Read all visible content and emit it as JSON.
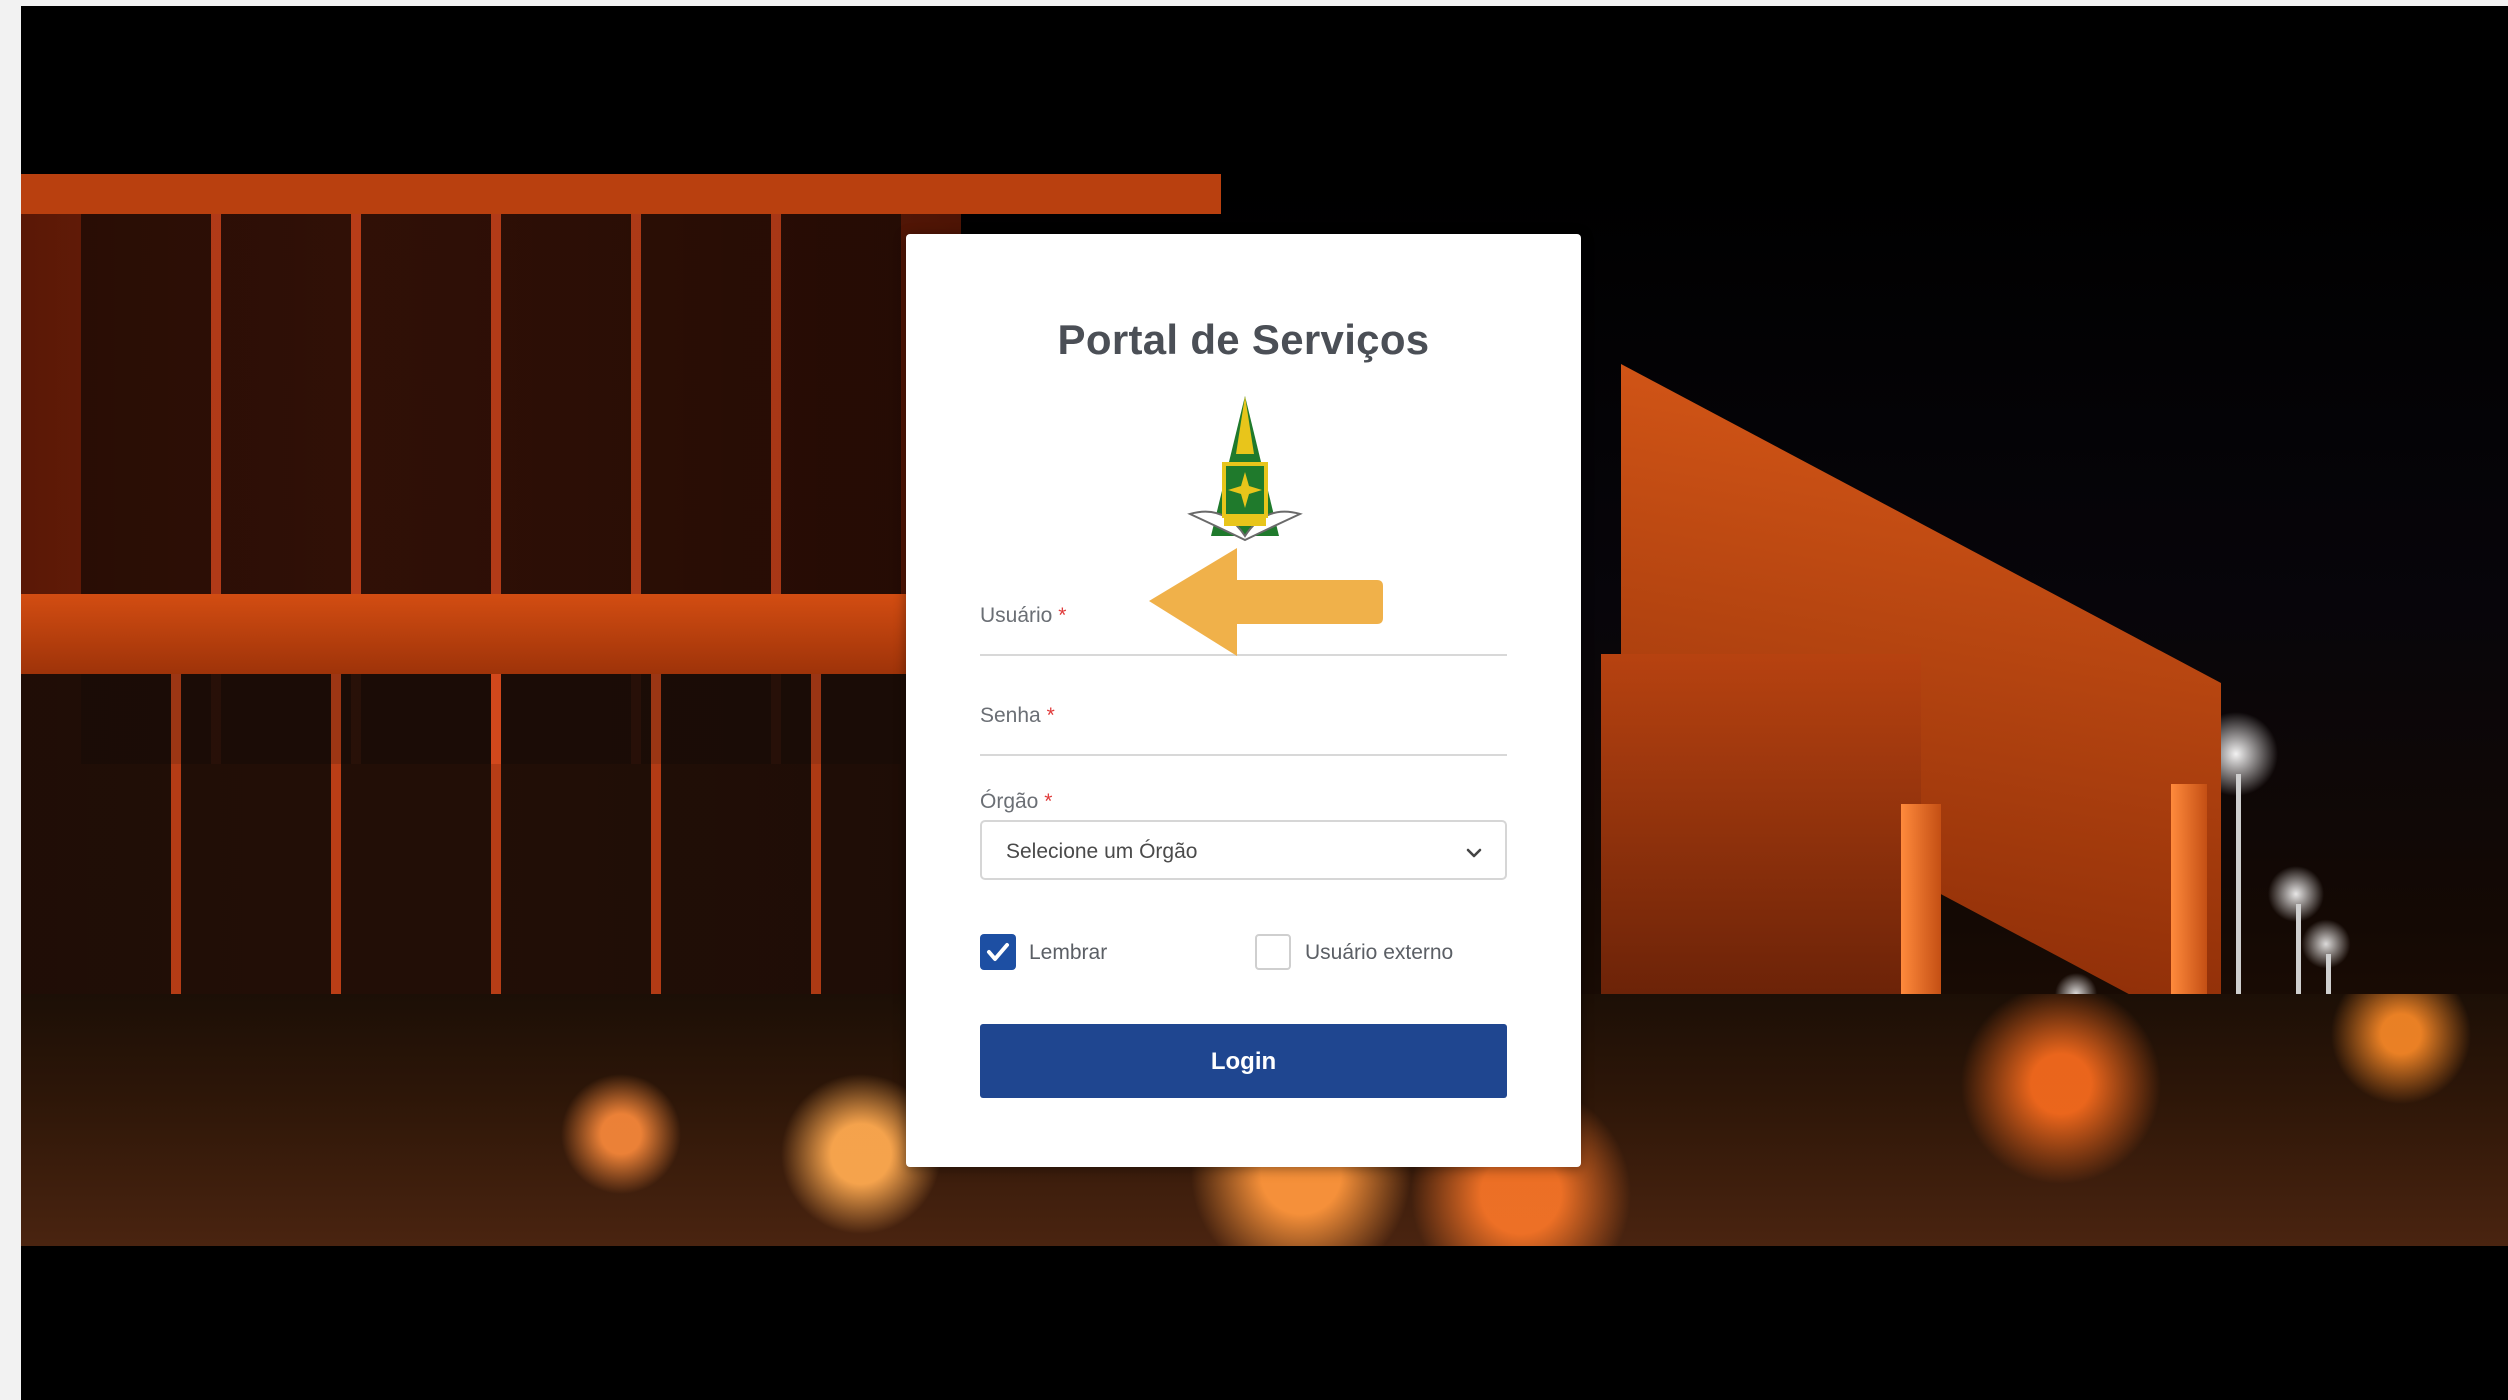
{
  "login": {
    "title": "Portal de Serviços",
    "username_label": "Usuário",
    "password_label": "Senha",
    "org_label": "Órgão",
    "required_mark": "*",
    "org_select_value": "Selecione um Órgão",
    "remember_label": "Lembrar",
    "remember_checked": true,
    "external_user_label": "Usuário externo",
    "external_user_checked": false,
    "login_button_label": "Login"
  },
  "icons": {
    "crest": "distrito-federal-coat-of-arms-icon",
    "dropdown": "chevron-down-icon",
    "checkmark": "checkmark-icon",
    "annotation": "left-arrow-annotation-icon"
  },
  "colors": {
    "primary": "#1f4690",
    "checkbox_checked": "#1d4fa3",
    "required": "#e03b3b",
    "arrow": "#f0b14a",
    "crest_green": "#1f7a2c",
    "crest_yellow": "#e8c51b"
  }
}
